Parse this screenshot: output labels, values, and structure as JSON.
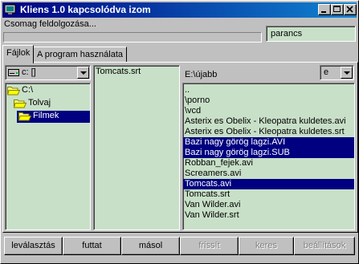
{
  "window": {
    "title": "Kliens 1.0 kapcsolódva izom"
  },
  "status": {
    "text": "Csomag feldolgozása...",
    "progress": 0
  },
  "command": {
    "value": "parancs"
  },
  "tabs": [
    {
      "label": "Fájlok",
      "active": true
    },
    {
      "label": "A program használata",
      "active": false
    }
  ],
  "left": {
    "drive": "c: []",
    "dirs": [
      {
        "label": "C:\\",
        "icon": "open-folder-icon",
        "level": 0,
        "selected": false
      },
      {
        "label": "Tolvaj",
        "icon": "open-folder-icon",
        "level": 1,
        "selected": false
      },
      {
        "label": "Filmek",
        "icon": "open-folder-icon",
        "level": 2,
        "selected": true
      }
    ]
  },
  "middle": {
    "files": [
      "Tomcats.srt"
    ]
  },
  "right": {
    "path": "E:\\újabb",
    "drive": "e",
    "items": [
      {
        "name": "..",
        "selected": false
      },
      {
        "name": "\\porno",
        "selected": false
      },
      {
        "name": "\\vcd",
        "selected": false
      },
      {
        "name": "Asterix es Obelix - Kleopatra kuldetes.avi",
        "selected": false
      },
      {
        "name": "Asterix es Obelix - Kleopatra kuldetes.srt",
        "selected": false
      },
      {
        "name": "Bazi nagy görög lagzi.AVI",
        "selected": true
      },
      {
        "name": "Bazi nagy görög lagzi.SUB",
        "selected": true
      },
      {
        "name": "Robban_fejek.avi",
        "selected": false
      },
      {
        "name": "Screamers.avi",
        "selected": false
      },
      {
        "name": "Tomcats.avi",
        "selected": true
      },
      {
        "name": "Tomcats.srt",
        "selected": false
      },
      {
        "name": "Van Wilder.avi",
        "selected": false
      },
      {
        "name": "Van Wilder.srt",
        "selected": false
      }
    ]
  },
  "buttons": [
    {
      "label": "leválasztás",
      "enabled": true
    },
    {
      "label": "futtat",
      "enabled": true
    },
    {
      "label": "másol",
      "enabled": true
    },
    {
      "label": "frissít",
      "enabled": false
    },
    {
      "label": "keres",
      "enabled": false
    },
    {
      "label": "beállítások",
      "enabled": false
    }
  ],
  "colors": {
    "titlebar": "#000080",
    "listbg": "#c8e0c8",
    "selection": "#000080",
    "face": "#c0c0c0"
  }
}
